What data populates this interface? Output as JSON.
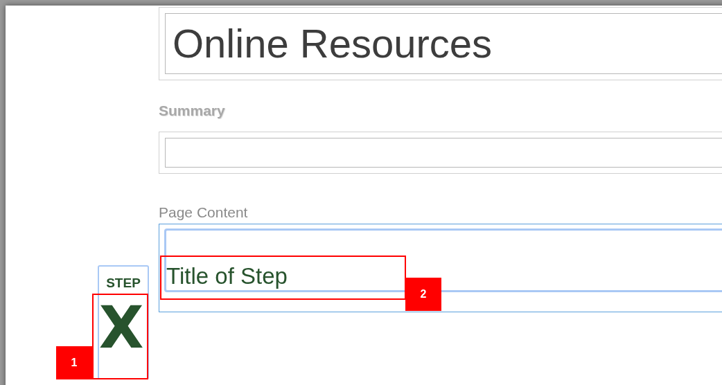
{
  "title_field": {
    "value": "Online Resources"
  },
  "summary": {
    "label": "Summary"
  },
  "page_content": {
    "label": "Page Content",
    "heading": "Title of Step"
  },
  "step_marker": {
    "label": "STEP",
    "mark": "X"
  },
  "callouts": [
    {
      "number": "1"
    },
    {
      "number": "2"
    }
  ]
}
